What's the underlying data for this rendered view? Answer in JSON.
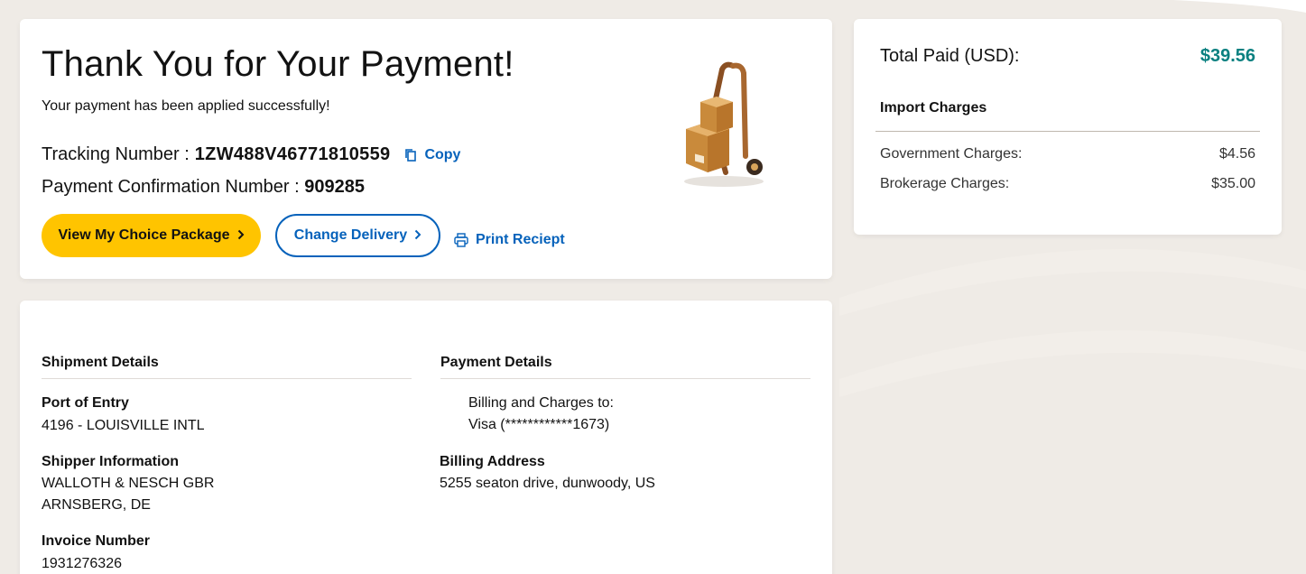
{
  "confirmation": {
    "title": "Thank You for Your Payment!",
    "subtitle": "Your payment has been applied successfully!",
    "tracking_label": "Tracking Number :",
    "tracking_number": "1ZW488V46771810559",
    "copy_label": "Copy",
    "confirmation_label": "Payment Confirmation Number :",
    "confirmation_number": "909285",
    "buttons": {
      "view_package": "View My Choice Package",
      "change_delivery": "Change Delivery",
      "print_receipt": "Print Reciept"
    }
  },
  "summary": {
    "total_label": "Total Paid (USD):",
    "total_value": "$39.56",
    "section_title": "Import Charges",
    "lines": [
      {
        "label": "Government Charges:",
        "value": "$4.56"
      },
      {
        "label": "Brokerage Charges:",
        "value": "$35.00"
      }
    ]
  },
  "shipment": {
    "title": "Shipment Details",
    "port_label": "Port of Entry",
    "port_value": "4196 - LOUISVILLE INTL",
    "shipper_label": "Shipper Information",
    "shipper_line1": "WALLOTH & NESCH GBR",
    "shipper_line2": "ARNSBERG, DE",
    "invoice_label": "Invoice Number",
    "invoice_value": "1931276326"
  },
  "payment": {
    "title": "Payment Details",
    "billing_to_label": "Billing and Charges to:",
    "card": "Visa (************1673)",
    "address_label": "Billing Address",
    "address_value": "5255 seaton drive, dunwoody, US"
  },
  "colors": {
    "accent_yellow": "#ffc400",
    "link_blue": "#0662bb",
    "total_teal": "#0a8080"
  }
}
